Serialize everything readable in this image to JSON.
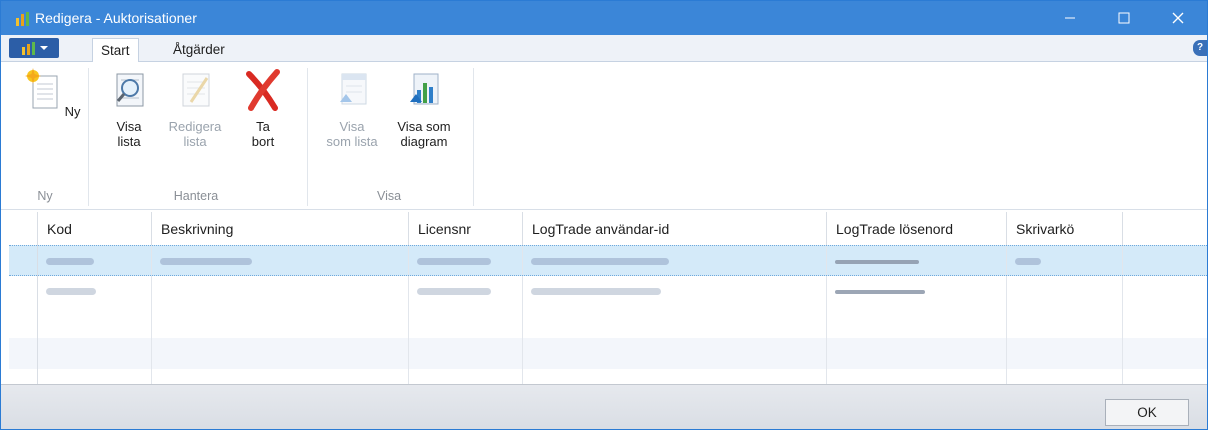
{
  "window": {
    "title": "Redigera - Auktorisationer"
  },
  "tabs": [
    {
      "label": "Start",
      "active": true
    },
    {
      "label": "Åtgärder",
      "active": false
    }
  ],
  "ribbon": {
    "buttons": {
      "ny": {
        "line1": "Ny",
        "line2": ""
      },
      "visa_lista": {
        "line1": "Visa",
        "line2": "lista"
      },
      "redigera_lista": {
        "line1": "Redigera",
        "line2": "lista",
        "disabled": true
      },
      "ta_bort": {
        "line1": "Ta",
        "line2": "bort"
      },
      "visa_som_lista": {
        "line1": "Visa",
        "line2": "som lista",
        "disabled": true
      },
      "visa_som_diagram": {
        "line1": "Visa som",
        "line2": "diagram"
      }
    },
    "groups": {
      "ny": "Ny",
      "hantera": "Hantera",
      "visa": "Visa"
    }
  },
  "grid": {
    "columns": [
      "Kod",
      "Beskrivning",
      "Licensnr",
      "LogTrade användar-id",
      "LogTrade lösenord",
      "Skrivarkö"
    ]
  },
  "footer": {
    "ok_label": "OK"
  },
  "colors": {
    "titlebar": "#3b86d8",
    "selected_row": "#d4eaf9"
  }
}
